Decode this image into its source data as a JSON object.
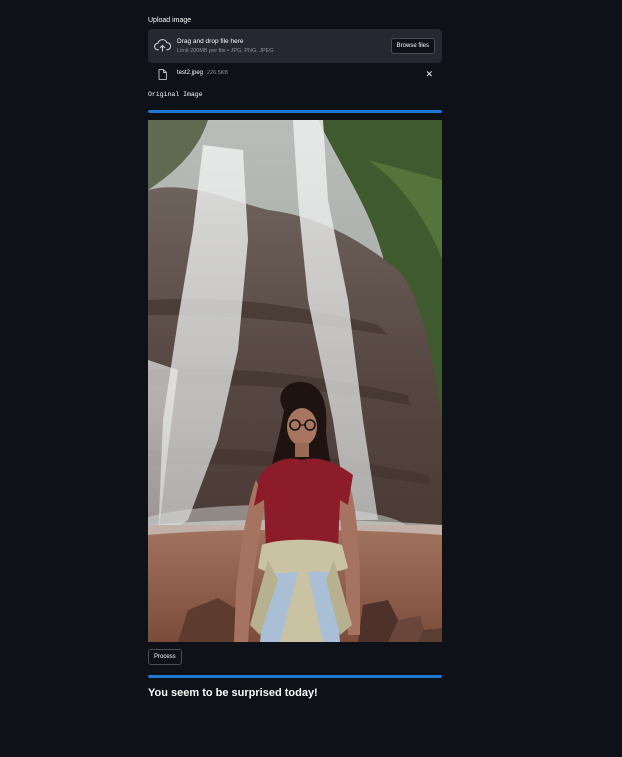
{
  "uploader": {
    "label": "Upload image",
    "drop_title": "Drag and drop file here",
    "drop_limits": "Limit 200MB per file • JPG, PNG, JPEG",
    "browse_label": "Browse files",
    "icon": "cloud-upload-icon"
  },
  "file": {
    "name": "test2.jpeg",
    "size": "226.5KB",
    "icon": "file-icon",
    "remove_glyph": "✕"
  },
  "original_label": "Original Image",
  "progress_top": {
    "value": 100
  },
  "process_label": "Process",
  "progress_bottom": {
    "value": 100
  },
  "result_text": "You seem to be surprised today!",
  "colors": {
    "background": "#0e1117",
    "dropzone": "#262730",
    "accent": "#1f77d4",
    "text": "#fafafa",
    "muted": "#8c8f99"
  }
}
